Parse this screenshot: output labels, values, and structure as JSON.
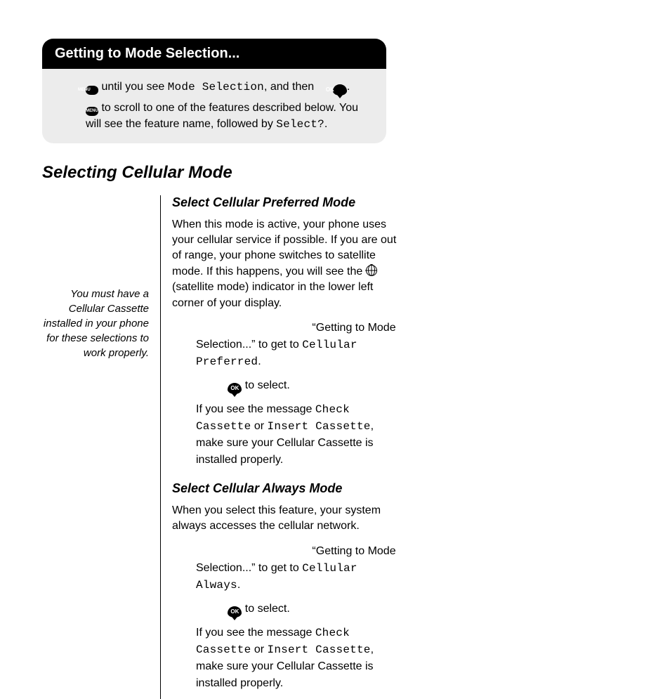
{
  "box": {
    "title": "Getting to Mode Selection...",
    "line1_a": " until you see ",
    "line1_lcd": "Mode Selection",
    "line1_b": ", and then ",
    "line1_c": ".",
    "line2_a": " to scroll to one of the features described below. You will see the feature name, followed by ",
    "line2_lcd": "Select?",
    "line2_b": "."
  },
  "h1": "Selecting Cellular Mode",
  "sidenote": "You must have a Cellular Cassette installed in your phone for these selections to work properly.",
  "preferred": {
    "title": "Select Cellular Preferred Mode",
    "p1_a": "When this mode is active, your phone uses your cellular service if possible. If you are out of range, your phone switches to satellite mode. If this happens, you will see the ",
    "p1_b": " (satellite mode) indicator in the lower left corner of your display.",
    "step1_a": "“Getting to Mode Selection...” to get to ",
    "step1_lcd": "Cellular Preferred",
    "step1_b": ".",
    "step2_a": " to select.",
    "p2_a": "If you see the message ",
    "p2_lcd1": "Check Cassette",
    "p2_b": " or ",
    "p2_lcd2": "Insert Cassette",
    "p2_c": ", make sure your Cellular Cassette is installed properly."
  },
  "always": {
    "title": "Select Cellular Always Mode",
    "p1": "When you select this feature, your system always accesses the cellular network.",
    "step1_a": "“Getting to Mode Selection...” to get to ",
    "step1_lcd": "Cellular Always",
    "step1_b": ".",
    "step2_a": " to select.",
    "p2_a": "If you see the message ",
    "p2_lcd1": "Check Cassette",
    "p2_b": " or ",
    "p2_lcd2": "Insert Cassette",
    "p2_c": ", make sure your Cellular Cassette is installed properly."
  },
  "icons": {
    "menu": "MENU",
    "ok": "OK"
  }
}
